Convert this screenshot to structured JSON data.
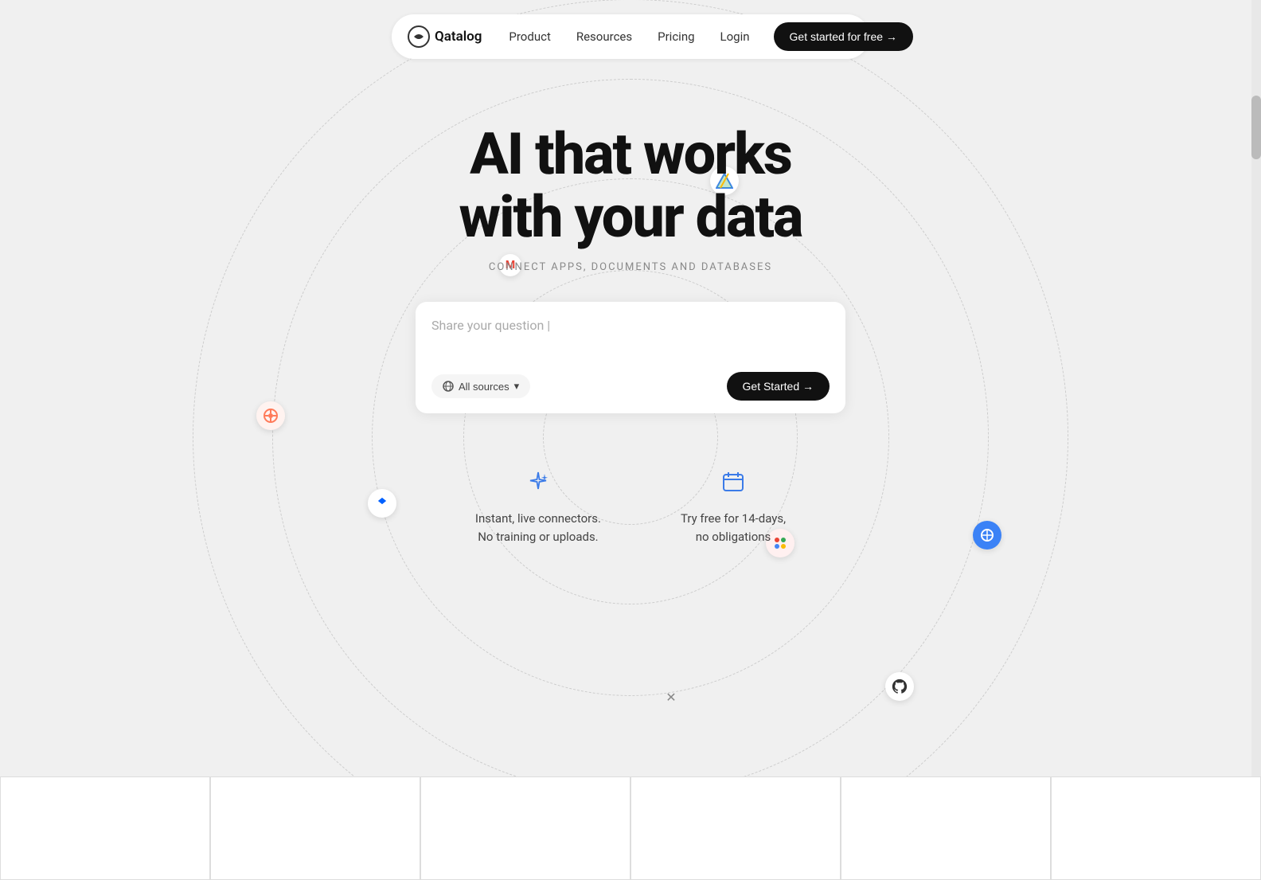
{
  "brand": {
    "name": "Qatalog",
    "logo_symbol": "Q"
  },
  "navbar": {
    "links": [
      {
        "id": "product",
        "label": "Product"
      },
      {
        "id": "resources",
        "label": "Resources"
      },
      {
        "id": "pricing",
        "label": "Pricing"
      },
      {
        "id": "login",
        "label": "Login"
      }
    ],
    "cta_label": "Get started for free →"
  },
  "hero": {
    "headline_line1": "AI that works",
    "headline_line2": "with your data",
    "subtitle": "Connect apps, documents and databases",
    "search_placeholder": "Share your question |",
    "sources_label": "All sources",
    "get_started_label": "Get Started →"
  },
  "features": [
    {
      "id": "instant-connectors",
      "icon": "✦",
      "text_line1": "Instant, live connectors.",
      "text_line2": "No training or uploads."
    },
    {
      "id": "free-trial",
      "icon": "📅",
      "text_line1": "Try free for 14-days,",
      "text_line2": "no obligations"
    }
  ],
  "floating_icons": [
    {
      "id": "gdrive",
      "symbol": "▲",
      "color": "#4285F4",
      "title": "Google Drive"
    },
    {
      "id": "gmail",
      "symbol": "M",
      "color": "#EA4335",
      "title": "Gmail"
    },
    {
      "id": "hubspot",
      "symbol": "⚙",
      "color": "#ff7a59",
      "title": "HubSpot"
    },
    {
      "id": "dropbox",
      "symbol": "◆",
      "color": "#0061FF",
      "title": "Dropbox"
    },
    {
      "id": "notion",
      "symbol": "◉",
      "color": "#4A90E2",
      "title": "Notion"
    },
    {
      "id": "analytics",
      "symbol": "⚏",
      "color": "#E8453C",
      "title": "Analytics"
    },
    {
      "id": "github",
      "symbol": "⊙",
      "color": "#333",
      "title": "GitHub"
    },
    {
      "id": "small-icon",
      "symbol": "✕",
      "color": "#888",
      "title": "Small icon"
    }
  ],
  "bottom_cells_count": 6
}
